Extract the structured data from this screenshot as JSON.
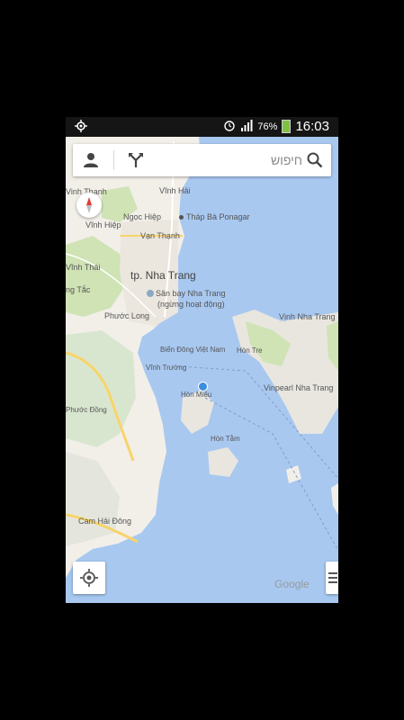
{
  "status_bar": {
    "battery": "76%",
    "time": "16:03"
  },
  "search": {
    "placeholder": "חיפוש"
  },
  "map_labels": {
    "vinh_thanh": "Vinh Thạnh",
    "vinh_hai": "Vĩnh Hải",
    "ngoc_hiep": "Ngọc Hiệp",
    "thap_ba": "Tháp Bà Ponagar",
    "vinh_hiep": "Vĩnh Hiệp",
    "van_thanh": "Vạn Thạnh",
    "vinh_thai": "Vĩnh Thái",
    "city": "tp. Nha Trang",
    "airport_line1": "Sân bay Nha Trang",
    "airport_line2": "(ngừng hoạt động)",
    "vinh_nha_trang": "Vịnh Nha Trang",
    "ng_tac": "ng Tắc",
    "phuoc_long": "Phước Long",
    "bien_dong": "Biển Đông Việt Nam",
    "hon_tre": "Hòn Tre",
    "vinh_truong": "Vĩnh Trường",
    "vinpearl": "Vinpearl Nha Trang",
    "hon_mieu": "Hòn Miễu",
    "phuoc_dong": "Phước Đồng",
    "hon_tam": "Hòn Tằm",
    "cam_hai_dong": "Cam Hải Đông"
  },
  "watermark": "Google",
  "colors": {
    "water": "#a8c8f0",
    "land": "#f2efe9",
    "green": "#cfe3b4",
    "road": "#f7d46b",
    "location_dot": "#3b8ede"
  }
}
